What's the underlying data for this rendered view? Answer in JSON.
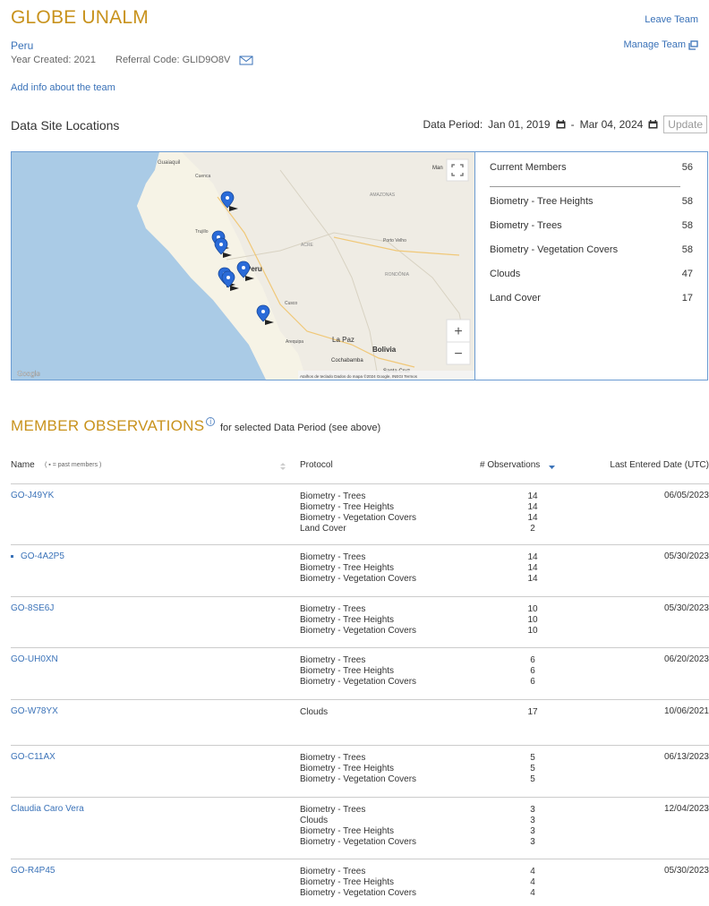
{
  "team": {
    "title": "GLOBE UNALM",
    "country": "Peru",
    "year_created": "Year Created: 2021",
    "referral_code": "Referral Code: GLID9O8V",
    "leave_label": "Leave Team",
    "manage_label": "Manage Team",
    "add_info_label": "Add info about the team"
  },
  "data_sites": {
    "title": "Data Site Locations",
    "period_label": "Data Period:",
    "start_date": "Jan 01, 2019",
    "separator": "-",
    "end_date": "Mar 04, 2024",
    "update_label": "Update"
  },
  "map": {
    "labels": [
      "Guaiaquil",
      "Cuenca",
      "Trujillo",
      "AMAZONAS",
      "ACRE",
      "Porto Velho",
      "RONDÔNIA",
      "Cusco",
      "Arequipa",
      "La Paz",
      "Bolivia",
      "Cochabamba",
      "Santa Cruz",
      "Peru",
      "Man"
    ],
    "zoom_in": "+",
    "zoom_out": "−",
    "google": "Google",
    "attribution": "Atalhos de teclado   Dados do mapa ©2024 Google, INEGI   Termos"
  },
  "stats": [
    {
      "label": "Current Members",
      "value": "56"
    },
    {
      "label": "Biometry - Tree Heights",
      "value": "58"
    },
    {
      "label": "Biometry - Trees",
      "value": "58"
    },
    {
      "label": "Biometry - Vegetation Covers",
      "value": "58"
    },
    {
      "label": "Clouds",
      "value": "47"
    },
    {
      "label": "Land Cover",
      "value": "17"
    }
  ],
  "observations": {
    "title": "MEMBER OBSERVATIONS",
    "info_glyph": "i",
    "subtitle": "for selected Data Period (see above)",
    "headers": {
      "name": "Name",
      "past_members": "( ▪ = past members )",
      "protocol": "Protocol",
      "observations": "# Observations",
      "last_date": "Last Entered Date (UTC)"
    },
    "rows": [
      {
        "name": "GO-J49YK",
        "past": false,
        "protocols": [
          "Biometry - Trees",
          "Biometry - Tree Heights",
          "Biometry - Vegetation Covers",
          "Land Cover"
        ],
        "counts": [
          "14",
          "14",
          "14",
          "2"
        ],
        "date": "06/05/2023"
      },
      {
        "name": "GO-4A2P5",
        "past": true,
        "protocols": [
          "Biometry - Trees",
          "Biometry - Tree Heights",
          "Biometry - Vegetation Covers"
        ],
        "counts": [
          "14",
          "14",
          "14"
        ],
        "date": "05/30/2023"
      },
      {
        "name": "GO-8SE6J",
        "past": false,
        "protocols": [
          "Biometry - Trees",
          "Biometry - Tree Heights",
          "Biometry - Vegetation Covers"
        ],
        "counts": [
          "10",
          "10",
          "10"
        ],
        "date": "05/30/2023"
      },
      {
        "name": "GO-UH0XN",
        "past": false,
        "protocols": [
          "Biometry - Trees",
          "Biometry - Tree Heights",
          "Biometry - Vegetation Covers"
        ],
        "counts": [
          "6",
          "6",
          "6"
        ],
        "date": "06/20/2023"
      },
      {
        "name": "GO-W78YX",
        "past": false,
        "protocols": [
          "Clouds"
        ],
        "counts": [
          "17"
        ],
        "date": "10/06/2021"
      },
      {
        "name": "GO-C11AX",
        "past": false,
        "protocols": [
          "Biometry - Trees",
          "Biometry - Tree Heights",
          "Biometry - Vegetation Covers"
        ],
        "counts": [
          "5",
          "5",
          "5"
        ],
        "date": "06/13/2023"
      },
      {
        "name": "Claudia Caro Vera",
        "past": false,
        "protocols": [
          "Biometry - Trees",
          "Clouds",
          "Biometry - Tree Heights",
          "Biometry - Vegetation Covers"
        ],
        "counts": [
          "3",
          "3",
          "3",
          "3"
        ],
        "date": "12/04/2023"
      },
      {
        "name": "GO-R4P45",
        "past": false,
        "protocols": [
          "Biometry - Trees",
          "Biometry - Tree Heights",
          "Biometry - Vegetation Covers"
        ],
        "counts": [
          "4",
          "4",
          "4"
        ],
        "date": "05/30/2023"
      }
    ]
  },
  "colors": {
    "accent": "#c8921c",
    "link": "#3a72b8",
    "border": "#6a9bd2",
    "marker": "#2a6bd8"
  }
}
